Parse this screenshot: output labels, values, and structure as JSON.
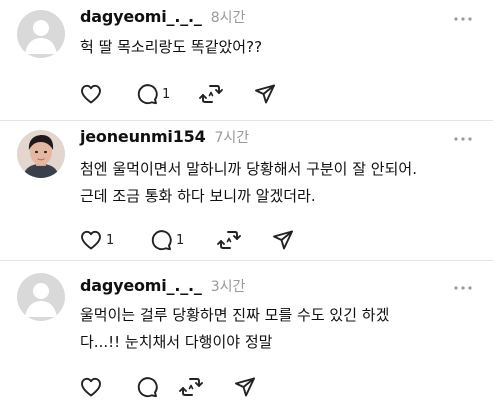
{
  "posts": [
    {
      "username": "dagyeomi_._._",
      "time": "8시간",
      "lines": [
        "헉 딸 목소리랑도 똑같았어??"
      ],
      "like_count": "",
      "comment_count": "1"
    },
    {
      "username": "jeoneunmi154",
      "time": "7시간",
      "lines": [
        "첨엔 울먹이면서 말하니까 당황해서 구분이 잘 안되어.",
        "근데 조금 통화 하다 보니까 알겠더라."
      ],
      "like_count": "1",
      "comment_count": "1"
    },
    {
      "username": "dagyeomi_._._",
      "time": "3시간",
      "lines": [
        "울먹이는 걸루 당황하면 진짜 모를 수도 있긴 하겠",
        "다...!! 눈치채서 다행이야 정말"
      ],
      "like_count": "",
      "comment_count": ""
    }
  ],
  "icons": {
    "more": "more-horizontal-icon",
    "like": "heart-icon",
    "comment": "comment-bubble-icon",
    "repost": "repost-icon",
    "share": "send-paper-plane-icon"
  },
  "colors": {
    "text": "#101010",
    "muted": "#999999",
    "icon": "#222222",
    "avatar_placeholder": "#d9d9d9",
    "divider": "#e5e5e5"
  }
}
